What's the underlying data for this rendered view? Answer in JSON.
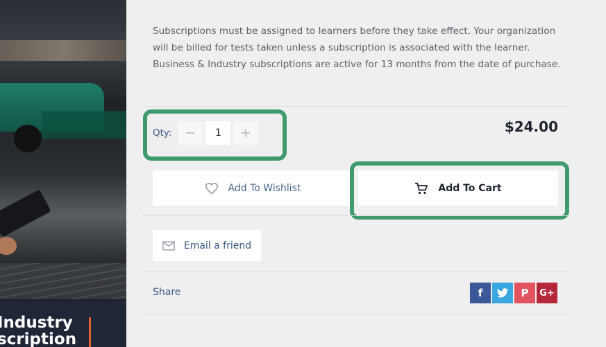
{
  "product": {
    "description": "Subscriptions must be assigned to learners before they take effect. Your organization will be billed for tests taken unless a subscription is associated with the learner. Business & Industry subscriptions are active for 13 months from the date of purchase.",
    "image_banner_text": "Industry\nscription"
  },
  "quantity": {
    "label": "Qty:",
    "value": "1",
    "minus_icon": "minus-icon",
    "plus_icon": "plus-icon"
  },
  "price": "$24.00",
  "actions": {
    "wishlist_label": "Add To Wishlist",
    "wishlist_icon": "heart-icon",
    "cart_label": "Add To Cart",
    "cart_icon": "cart-icon",
    "email_label": "Email a friend",
    "email_icon": "mail-icon"
  },
  "share": {
    "label": "Share",
    "networks": [
      {
        "name": "facebook",
        "glyph": "f",
        "color": "#3b5998"
      },
      {
        "name": "twitter",
        "glyph": "",
        "color": "#3aa7e0"
      },
      {
        "name": "pinterest",
        "glyph": "P",
        "color": "#e3535f"
      },
      {
        "name": "google-plus",
        "glyph": "G+",
        "color": "#b4283a"
      }
    ]
  },
  "colors": {
    "highlight": "#3f9a6e",
    "price": "#1f2530",
    "link": "#3b5a84"
  }
}
